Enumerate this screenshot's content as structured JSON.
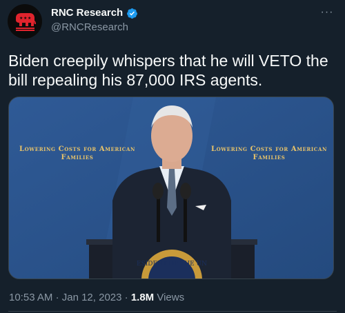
{
  "author": {
    "display_name": "RNC Research",
    "handle": "@RNCResearch",
    "verified": true,
    "avatar_icon": "republican-elephant-icon",
    "avatar_color": "#e0242d"
  },
  "tweet": {
    "text": "Biden creepily whispers that he will VETO the bill repealing his 87,000 IRS agents."
  },
  "media": {
    "banner_left": "Lowering Costs for American Families",
    "banner_right": "Lowering Costs for American Families",
    "seal_text": "ESIDENT OF THE UN"
  },
  "meta": {
    "time": "10:53 AM",
    "date": "Jan 12, 2023",
    "views_count": "1.8M",
    "views_label": "Views"
  },
  "colors": {
    "background": "#15202b",
    "text": "#f7f9f9",
    "secondary_text": "#8b98a5",
    "verified": "#1d9bf0",
    "banner_text": "#e9c46a"
  }
}
